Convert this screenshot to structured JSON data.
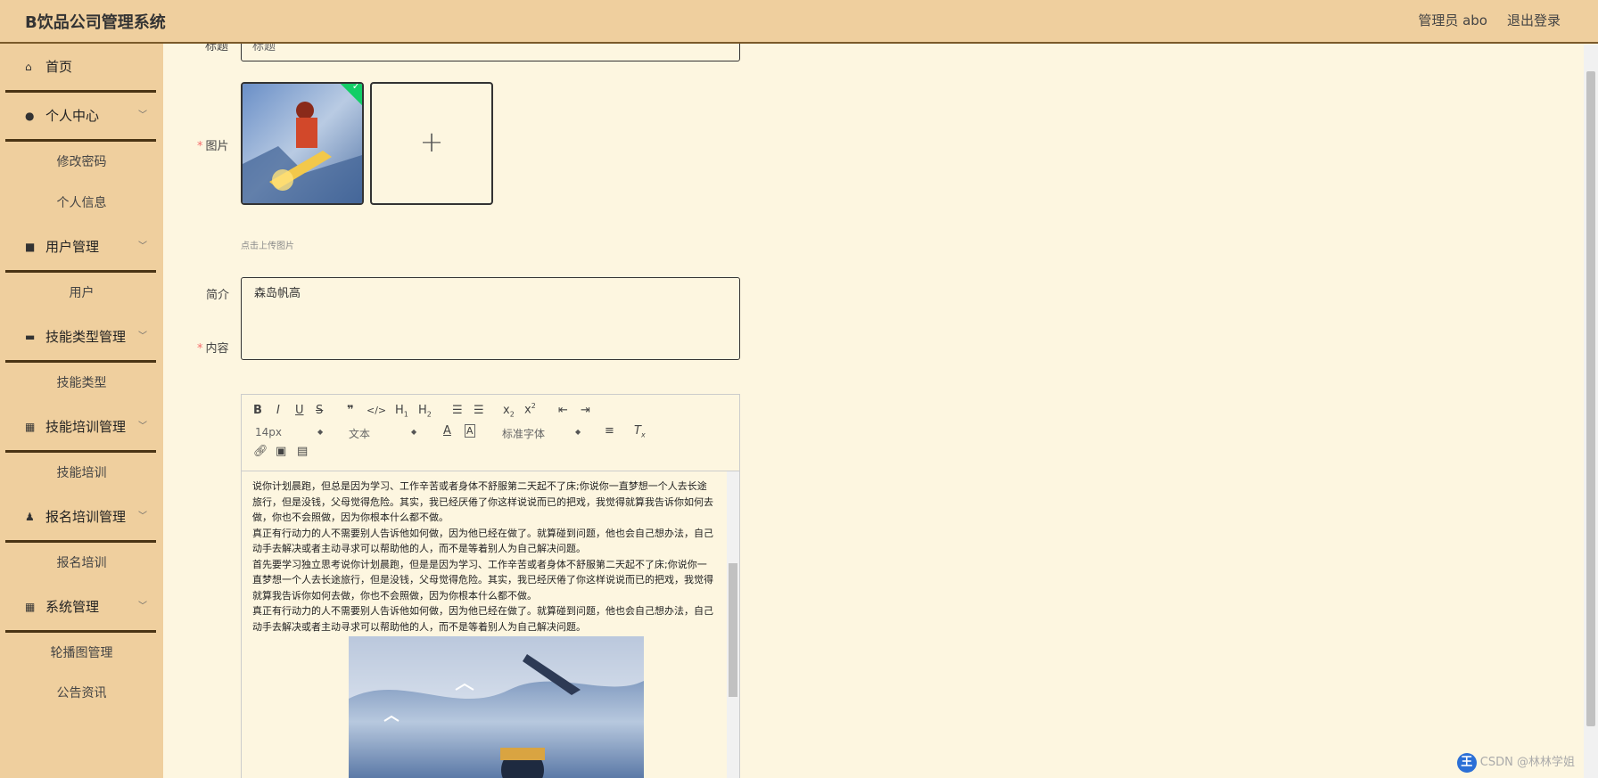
{
  "header": {
    "title": "B饮品公司管理系统",
    "user": "管理员 abo",
    "logout": "退出登录"
  },
  "sidebar": {
    "home": "首页",
    "personal_center": "个人中心",
    "change_password": "修改密码",
    "personal_info": "个人信息",
    "user_mgmt": "用户管理",
    "user": "用户",
    "skill_type_mgmt": "技能类型管理",
    "skill_type": "技能类型",
    "skill_training_mgmt": "技能培训管理",
    "skill_training": "技能培训",
    "enroll_training_mgmt": "报名培训管理",
    "enroll_training": "报名培训",
    "system_mgmt": "系统管理",
    "carousel_mgmt": "轮播图管理",
    "announcements": "公告资讯"
  },
  "form": {
    "title_label": "标题",
    "title_value": "标题",
    "image_label": "图片",
    "upload_tip": "点击上传图片",
    "intro_label": "简介",
    "intro_value": "森岛帆高",
    "content_label": "内容"
  },
  "editor": {
    "font_size": "14px",
    "header_select": "文本",
    "font_family": "标准字体",
    "paragraphs": [
      "说你计划晨跑，但总是因为学习、工作辛苦或者身体不舒服第二天起不了床;你说你一直梦想一个人去长途旅行，但是没钱，父母觉得危险。其实，我已经厌倦了你这样说说而已的把戏，我觉得就算我告诉你如何去做，你也不会照做，因为你根本什么都不做。",
      "真正有行动力的人不需要别人告诉他如何做，因为他已经在做了。就算碰到问题，他也会自己想办法，自己动手去解决或者主动寻求可以帮助他的人，而不是等着别人为自己解决问题。",
      "首先要学习独立思考说你计划晨跑，但是是因为学习、工作辛苦或者身体不舒服第二天起不了床;你说你一直梦想一个人去长途旅行，但是没钱，父母觉得危险。其实，我已经厌倦了你这样说说而已的把戏，我觉得就算我告诉你如何去做，你也不会照做，因为你根本什么都不做。",
      "真正有行动力的人不需要别人告诉他如何做，因为他已经在做了。就算碰到问题，他也会自己想办法，自己动手去解决或者主动寻求可以帮助他的人，而不是等着别人为自己解决问题。"
    ]
  },
  "watermark": "CSDN @林林学姐",
  "colors": {
    "header_bg": "#efcf9e",
    "page_bg": "#fdf6e0",
    "divider": "#4a3414",
    "required": "#f56c6c",
    "success": "#13ce66"
  }
}
